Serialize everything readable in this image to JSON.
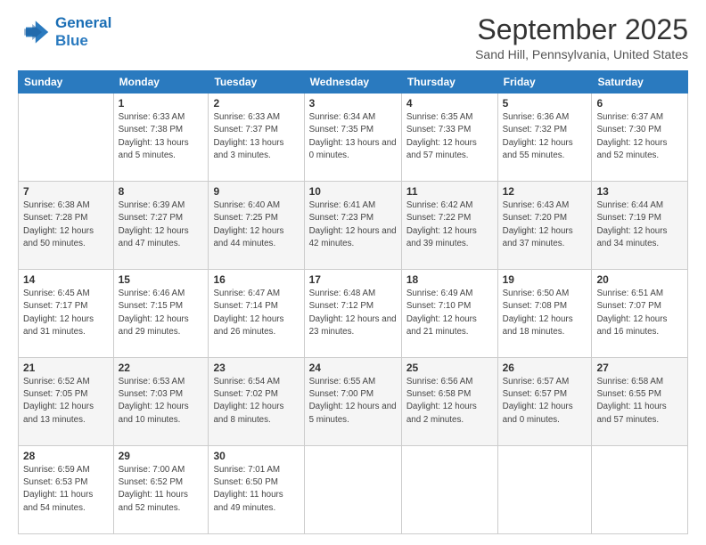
{
  "logo": {
    "line1": "General",
    "line2": "Blue"
  },
  "header": {
    "title": "September 2025",
    "subtitle": "Sand Hill, Pennsylvania, United States"
  },
  "weekdays": [
    "Sunday",
    "Monday",
    "Tuesday",
    "Wednesday",
    "Thursday",
    "Friday",
    "Saturday"
  ],
  "weeks": [
    [
      {
        "day": "",
        "sunrise": "",
        "sunset": "",
        "daylight": ""
      },
      {
        "day": "1",
        "sunrise": "Sunrise: 6:33 AM",
        "sunset": "Sunset: 7:38 PM",
        "daylight": "Daylight: 13 hours and 5 minutes."
      },
      {
        "day": "2",
        "sunrise": "Sunrise: 6:33 AM",
        "sunset": "Sunset: 7:37 PM",
        "daylight": "Daylight: 13 hours and 3 minutes."
      },
      {
        "day": "3",
        "sunrise": "Sunrise: 6:34 AM",
        "sunset": "Sunset: 7:35 PM",
        "daylight": "Daylight: 13 hours and 0 minutes."
      },
      {
        "day": "4",
        "sunrise": "Sunrise: 6:35 AM",
        "sunset": "Sunset: 7:33 PM",
        "daylight": "Daylight: 12 hours and 57 minutes."
      },
      {
        "day": "5",
        "sunrise": "Sunrise: 6:36 AM",
        "sunset": "Sunset: 7:32 PM",
        "daylight": "Daylight: 12 hours and 55 minutes."
      },
      {
        "day": "6",
        "sunrise": "Sunrise: 6:37 AM",
        "sunset": "Sunset: 7:30 PM",
        "daylight": "Daylight: 12 hours and 52 minutes."
      }
    ],
    [
      {
        "day": "7",
        "sunrise": "Sunrise: 6:38 AM",
        "sunset": "Sunset: 7:28 PM",
        "daylight": "Daylight: 12 hours and 50 minutes."
      },
      {
        "day": "8",
        "sunrise": "Sunrise: 6:39 AM",
        "sunset": "Sunset: 7:27 PM",
        "daylight": "Daylight: 12 hours and 47 minutes."
      },
      {
        "day": "9",
        "sunrise": "Sunrise: 6:40 AM",
        "sunset": "Sunset: 7:25 PM",
        "daylight": "Daylight: 12 hours and 44 minutes."
      },
      {
        "day": "10",
        "sunrise": "Sunrise: 6:41 AM",
        "sunset": "Sunset: 7:23 PM",
        "daylight": "Daylight: 12 hours and 42 minutes."
      },
      {
        "day": "11",
        "sunrise": "Sunrise: 6:42 AM",
        "sunset": "Sunset: 7:22 PM",
        "daylight": "Daylight: 12 hours and 39 minutes."
      },
      {
        "day": "12",
        "sunrise": "Sunrise: 6:43 AM",
        "sunset": "Sunset: 7:20 PM",
        "daylight": "Daylight: 12 hours and 37 minutes."
      },
      {
        "day": "13",
        "sunrise": "Sunrise: 6:44 AM",
        "sunset": "Sunset: 7:19 PM",
        "daylight": "Daylight: 12 hours and 34 minutes."
      }
    ],
    [
      {
        "day": "14",
        "sunrise": "Sunrise: 6:45 AM",
        "sunset": "Sunset: 7:17 PM",
        "daylight": "Daylight: 12 hours and 31 minutes."
      },
      {
        "day": "15",
        "sunrise": "Sunrise: 6:46 AM",
        "sunset": "Sunset: 7:15 PM",
        "daylight": "Daylight: 12 hours and 29 minutes."
      },
      {
        "day": "16",
        "sunrise": "Sunrise: 6:47 AM",
        "sunset": "Sunset: 7:14 PM",
        "daylight": "Daylight: 12 hours and 26 minutes."
      },
      {
        "day": "17",
        "sunrise": "Sunrise: 6:48 AM",
        "sunset": "Sunset: 7:12 PM",
        "daylight": "Daylight: 12 hours and 23 minutes."
      },
      {
        "day": "18",
        "sunrise": "Sunrise: 6:49 AM",
        "sunset": "Sunset: 7:10 PM",
        "daylight": "Daylight: 12 hours and 21 minutes."
      },
      {
        "day": "19",
        "sunrise": "Sunrise: 6:50 AM",
        "sunset": "Sunset: 7:08 PM",
        "daylight": "Daylight: 12 hours and 18 minutes."
      },
      {
        "day": "20",
        "sunrise": "Sunrise: 6:51 AM",
        "sunset": "Sunset: 7:07 PM",
        "daylight": "Daylight: 12 hours and 16 minutes."
      }
    ],
    [
      {
        "day": "21",
        "sunrise": "Sunrise: 6:52 AM",
        "sunset": "Sunset: 7:05 PM",
        "daylight": "Daylight: 12 hours and 13 minutes."
      },
      {
        "day": "22",
        "sunrise": "Sunrise: 6:53 AM",
        "sunset": "Sunset: 7:03 PM",
        "daylight": "Daylight: 12 hours and 10 minutes."
      },
      {
        "day": "23",
        "sunrise": "Sunrise: 6:54 AM",
        "sunset": "Sunset: 7:02 PM",
        "daylight": "Daylight: 12 hours and 8 minutes."
      },
      {
        "day": "24",
        "sunrise": "Sunrise: 6:55 AM",
        "sunset": "Sunset: 7:00 PM",
        "daylight": "Daylight: 12 hours and 5 minutes."
      },
      {
        "day": "25",
        "sunrise": "Sunrise: 6:56 AM",
        "sunset": "Sunset: 6:58 PM",
        "daylight": "Daylight: 12 hours and 2 minutes."
      },
      {
        "day": "26",
        "sunrise": "Sunrise: 6:57 AM",
        "sunset": "Sunset: 6:57 PM",
        "daylight": "Daylight: 12 hours and 0 minutes."
      },
      {
        "day": "27",
        "sunrise": "Sunrise: 6:58 AM",
        "sunset": "Sunset: 6:55 PM",
        "daylight": "Daylight: 11 hours and 57 minutes."
      }
    ],
    [
      {
        "day": "28",
        "sunrise": "Sunrise: 6:59 AM",
        "sunset": "Sunset: 6:53 PM",
        "daylight": "Daylight: 11 hours and 54 minutes."
      },
      {
        "day": "29",
        "sunrise": "Sunrise: 7:00 AM",
        "sunset": "Sunset: 6:52 PM",
        "daylight": "Daylight: 11 hours and 52 minutes."
      },
      {
        "day": "30",
        "sunrise": "Sunrise: 7:01 AM",
        "sunset": "Sunset: 6:50 PM",
        "daylight": "Daylight: 11 hours and 49 minutes."
      },
      {
        "day": "",
        "sunrise": "",
        "sunset": "",
        "daylight": ""
      },
      {
        "day": "",
        "sunrise": "",
        "sunset": "",
        "daylight": ""
      },
      {
        "day": "",
        "sunrise": "",
        "sunset": "",
        "daylight": ""
      },
      {
        "day": "",
        "sunrise": "",
        "sunset": "",
        "daylight": ""
      }
    ]
  ]
}
